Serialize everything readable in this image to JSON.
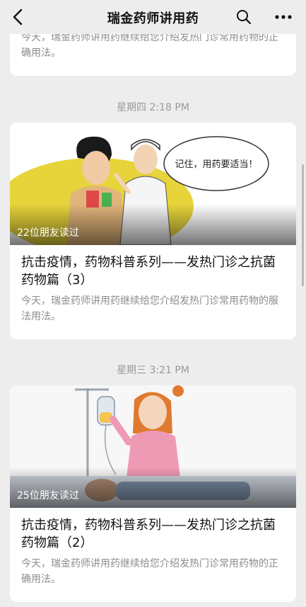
{
  "nav": {
    "title": "瑞金药师讲用药",
    "back_icon": "back-arrow-icon",
    "search_icon": "search-icon",
    "more_icon": "more-dots-icon"
  },
  "articles_partial": {
    "summary": "今天，瑞金药师讲用药继续给您介绍发热门诊常用药物的正确用法。"
  },
  "timeline": [
    {
      "timestamp": "星期四 2:18 PM",
      "read_count": "22位朋友读过",
      "title": "抗击疫情，药物科普系列——发热门诊之抗菌药物篇（3）",
      "summary": "今天，瑞金药师讲用药继续给您介绍发热门诊常用药物的服法用法。",
      "cover_speech": "记住，用药要适当！"
    },
    {
      "timestamp": "星期三 3:21 PM",
      "read_count": "25位朋友读过",
      "title": "抗击疫情，药物科普系列——发热门诊之抗菌药物篇（2）",
      "summary": "今天，瑞金药师讲用药继续给您介绍发热门诊常用药物的正确用法。"
    }
  ],
  "colors": {
    "background": "#ededed",
    "card": "#ffffff",
    "summary_text": "#8c8c8c",
    "timestamp_text": "#9a9a9a"
  }
}
